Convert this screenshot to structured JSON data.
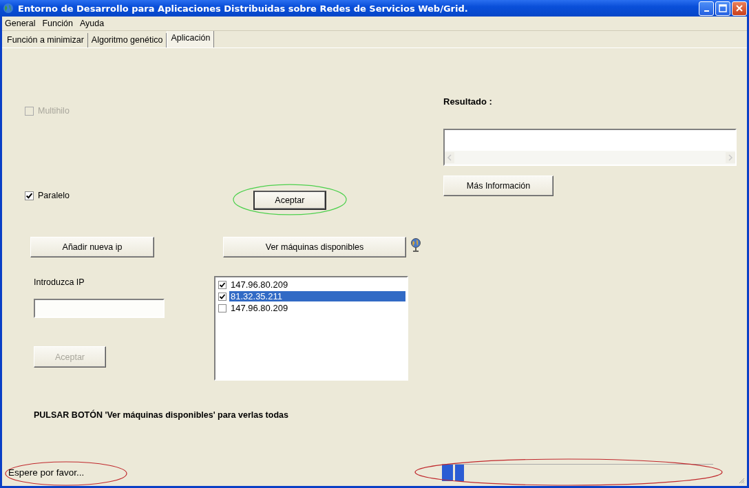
{
  "window": {
    "title": "Entorno de Desarrollo para Aplicaciones Distribuidas sobre Redes de Servicios Web/Grid."
  },
  "menu": [
    {
      "label": "General"
    },
    {
      "label": "Función"
    },
    {
      "label": "Ayuda"
    }
  ],
  "tabs": [
    {
      "label": "Función a minimizar",
      "selected": false
    },
    {
      "label": "Algoritmo genético",
      "selected": false
    },
    {
      "label": "Aplicación",
      "selected": true
    }
  ],
  "options": [
    {
      "label": "Multihilo",
      "checked": false,
      "disabled": true
    },
    {
      "label": "Paralelo",
      "checked": true,
      "disabled": false
    }
  ],
  "accept_button": {
    "label": "Aceptar"
  },
  "add_ip_button": {
    "label": "Añadir nueva ip"
  },
  "show_machines_button": {
    "label": "Ver máquinas disponibles"
  },
  "ip_input": {
    "label": "Introduzca IP"
  },
  "ip_accept_button": {
    "label": "Aceptar",
    "disabled": true
  },
  "machines": [
    {
      "ip": "147.96.80.209",
      "checked": true,
      "selected": false
    },
    {
      "ip": "81.32.35.211",
      "checked": true,
      "selected": true
    },
    {
      "ip": "147.96.80.209",
      "checked": false,
      "selected": false
    }
  ],
  "notice": "PULSAR BOTÓN 'Ver máquinas disponibles' para verlas todas",
  "result": {
    "label": "Resultado :"
  },
  "more_info_button": {
    "label": "Más Información"
  },
  "status_bar": {
    "text": "Espere por favor...",
    "progress": {
      "level": 0.08
    }
  }
}
